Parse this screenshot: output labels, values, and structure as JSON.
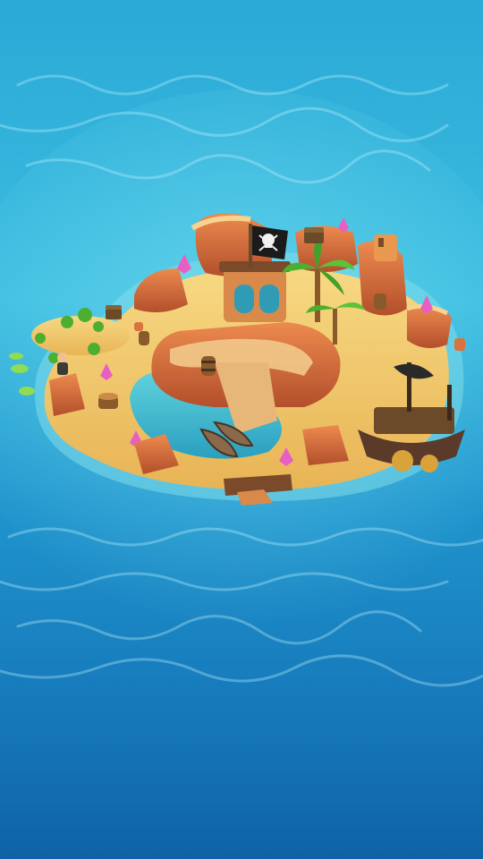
{
  "scene": {
    "colors": {
      "sky_top": "#3fb6d8",
      "sea_mid": "#1f95c9",
      "sea_deep": "#1164a8",
      "sand": "#f2c96b",
      "rock": "#d9733f",
      "rock_dark": "#a9472a",
      "lagoon": "#38b8c9",
      "palm": "#4caf2f",
      "crystal": "#e85fc4",
      "flag": "#1b1b1b",
      "ship_wood": "#5b3a2a"
    },
    "icons": {
      "flag": "pirate-flag-icon",
      "chest": "treasure-chest-icon",
      "crystal": "pink-crystal-icon",
      "ship": "pirate-ship-icon",
      "boat": "rowboat-icon",
      "barrel": "barrel-icon",
      "palm": "palm-tree-icon",
      "pirate": "pirate-character-icon"
    }
  }
}
